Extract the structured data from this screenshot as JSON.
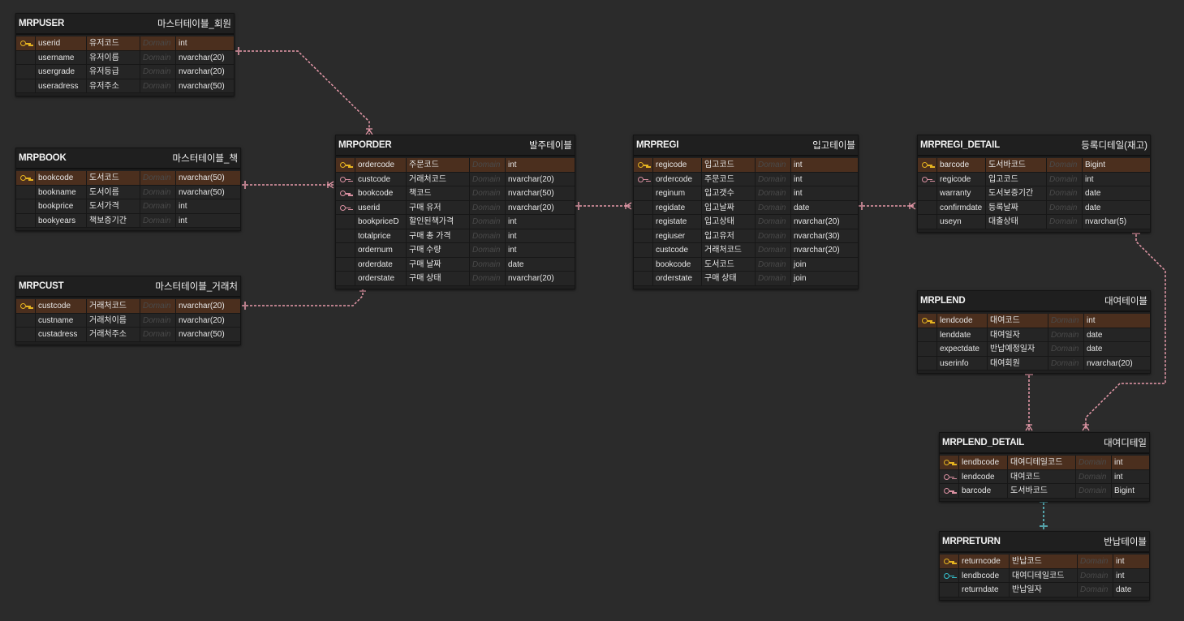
{
  "entities": [
    {
      "id": "mrpuser",
      "name": "MRPUSER",
      "label": "마스터테이블_회원",
      "columns": [
        {
          "key": "pk",
          "physical": "userid",
          "logical": "유저코드",
          "domain": "Domain",
          "type": "int"
        },
        {
          "key": "",
          "physical": "username",
          "logical": "유저이름",
          "domain": "Domain",
          "type": "nvarchar(20)"
        },
        {
          "key": "",
          "physical": "usergrade",
          "logical": "유저등급",
          "domain": "Domain",
          "type": "nvarchar(20)"
        },
        {
          "key": "",
          "physical": "useradress",
          "logical": "유저주소",
          "domain": "Domain",
          "type": "nvarchar(50)"
        }
      ]
    },
    {
      "id": "mrpbook",
      "name": "MRPBOOK",
      "label": "마스터테이블_책",
      "columns": [
        {
          "key": "pk",
          "physical": "bookcode",
          "logical": "도서코드",
          "domain": "Domain",
          "type": "nvarchar(50)"
        },
        {
          "key": "",
          "physical": "bookname",
          "logical": "도서이름",
          "domain": "Domain",
          "type": "nvarchar(50)"
        },
        {
          "key": "",
          "physical": "bookprice",
          "logical": "도서가격",
          "domain": "Domain",
          "type": "int"
        },
        {
          "key": "",
          "physical": "bookyears",
          "logical": "책보증기간",
          "domain": "Domain",
          "type": "int"
        }
      ]
    },
    {
      "id": "mrpcust",
      "name": "MRPCUST",
      "label": "마스터테이블_거래처",
      "columns": [
        {
          "key": "pk",
          "physical": "custcode",
          "logical": "거래처코드",
          "domain": "Domain",
          "type": "nvarchar(20)"
        },
        {
          "key": "",
          "physical": "custname",
          "logical": "거래처이름",
          "domain": "Domain",
          "type": "nvarchar(20)"
        },
        {
          "key": "",
          "physical": "custadress",
          "logical": "거래처주소",
          "domain": "Domain",
          "type": "nvarchar(50)"
        }
      ]
    },
    {
      "id": "mrporder",
      "name": "MRPORDER",
      "label": "발주테이블",
      "columns": [
        {
          "key": "pk",
          "physical": "ordercode",
          "logical": "주문코드",
          "domain": "Domain",
          "type": "int"
        },
        {
          "key": "fk",
          "physical": "custcode",
          "logical": "거래처코드",
          "domain": "Domain",
          "type": "nvarchar(20)"
        },
        {
          "key": "fk",
          "physical": "bookcode",
          "logical": "책코드",
          "domain": "Domain",
          "type": "nvarchar(50)"
        },
        {
          "key": "fk",
          "physical": "userid",
          "logical": "구매 유저",
          "domain": "Domain",
          "type": "nvarchar(20)"
        },
        {
          "key": "",
          "physical": "bookpriceD",
          "logical": "할인된책가격",
          "domain": "Domain",
          "type": "int"
        },
        {
          "key": "",
          "physical": "totalprice",
          "logical": "구매 총 가격",
          "domain": "Domain",
          "type": "int"
        },
        {
          "key": "",
          "physical": "ordernum",
          "logical": "구매 수량",
          "domain": "Domain",
          "type": "int"
        },
        {
          "key": "",
          "physical": "orderdate",
          "logical": "구매 날짜",
          "domain": "Domain",
          "type": "date"
        },
        {
          "key": "",
          "physical": "orderstate",
          "logical": "구매 상태",
          "domain": "Domain",
          "type": "nvarchar(20)"
        }
      ]
    },
    {
      "id": "mrpregi",
      "name": "MRPREGI",
      "label": "입고테이블",
      "columns": [
        {
          "key": "pk",
          "physical": "regicode",
          "logical": "입고코드",
          "domain": "Domain",
          "type": "int"
        },
        {
          "key": "fk",
          "physical": "ordercode",
          "logical": "주문코드",
          "domain": "Domain",
          "type": "int"
        },
        {
          "key": "",
          "physical": "reginum",
          "logical": "입고갯수",
          "domain": "Domain",
          "type": "int"
        },
        {
          "key": "",
          "physical": "regidate",
          "logical": "입고날짜",
          "domain": "Domain",
          "type": "date"
        },
        {
          "key": "",
          "physical": "registate",
          "logical": "입고상태",
          "domain": "Domain",
          "type": "nvarchar(20)"
        },
        {
          "key": "",
          "physical": "regiuser",
          "logical": "입고유저",
          "domain": "Domain",
          "type": "nvarchar(30)"
        },
        {
          "key": "",
          "physical": "custcode",
          "logical": "거래처코드",
          "domain": "Domain",
          "type": "nvarchar(20)"
        },
        {
          "key": "",
          "physical": "bookcode",
          "logical": "도서코드",
          "domain": "Domain",
          "type": "join"
        },
        {
          "key": "",
          "physical": "orderstate",
          "logical": "구매 상태",
          "domain": "Domain",
          "type": "join"
        }
      ]
    },
    {
      "id": "mrpregi_detail",
      "name": "MRPREGI_DETAIL",
      "label": "등록디테일(재고)",
      "columns": [
        {
          "key": "pk",
          "physical": "barcode",
          "logical": "도서바코드",
          "domain": "Domain",
          "type": "Bigint"
        },
        {
          "key": "fk",
          "physical": "regicode",
          "logical": "입고코드",
          "domain": "Domain",
          "type": "int"
        },
        {
          "key": "",
          "physical": "warranty",
          "logical": "도서보증기간",
          "domain": "Domain",
          "type": "date"
        },
        {
          "key": "",
          "physical": "confirmdate",
          "logical": "등록날짜",
          "domain": "Domain",
          "type": "date"
        },
        {
          "key": "",
          "physical": "useyn",
          "logical": "대출상태",
          "domain": "Domain",
          "type": "nvarchar(5)"
        }
      ]
    },
    {
      "id": "mrplend",
      "name": "MRPLEND",
      "label": "대여테이블",
      "columns": [
        {
          "key": "pk",
          "physical": "lendcode",
          "logical": "대여코드",
          "domain": "Domain",
          "type": "int"
        },
        {
          "key": "",
          "physical": "lenddate",
          "logical": "대여일자",
          "domain": "Domain",
          "type": "date"
        },
        {
          "key": "",
          "physical": "expectdate",
          "logical": "반납예정일자",
          "domain": "Domain",
          "type": "date"
        },
        {
          "key": "",
          "physical": "userinfo",
          "logical": "대여회원",
          "domain": "Domain",
          "type": "nvarchar(20)"
        }
      ]
    },
    {
      "id": "mrplend_detail",
      "name": "MRPLEND_DETAIL",
      "label": "대여디테일",
      "columns": [
        {
          "key": "pk",
          "physical": "lendbcode",
          "logical": "대여디테일코드",
          "domain": "Domain",
          "type": "int"
        },
        {
          "key": "fk",
          "physical": "lendcode",
          "logical": "대여코드",
          "domain": "Domain",
          "type": "int"
        },
        {
          "key": "fk",
          "physical": "barcode",
          "logical": "도서바코드",
          "domain": "Domain",
          "type": "Bigint"
        }
      ]
    },
    {
      "id": "mrpreturn",
      "name": "MRPRETURN",
      "label": "반납테이블",
      "columns": [
        {
          "key": "pk",
          "physical": "returncode",
          "logical": "반납코드",
          "domain": "Domain",
          "type": "int"
        },
        {
          "key": "pfk",
          "physical": "lendbcode",
          "logical": "대여디테일코드",
          "domain": "Domain",
          "type": "int"
        },
        {
          "key": "",
          "physical": "returndate",
          "logical": "반납일자",
          "domain": "Domain",
          "type": "date"
        }
      ]
    }
  ],
  "relationships": [
    {
      "from": "mrpuser",
      "to": "mrporder",
      "color": "#e79aaa"
    },
    {
      "from": "mrpbook",
      "to": "mrporder",
      "color": "#e79aaa"
    },
    {
      "from": "mrpcust",
      "to": "mrporder",
      "color": "#e79aaa"
    },
    {
      "from": "mrporder",
      "to": "mrpregi",
      "color": "#e79aaa"
    },
    {
      "from": "mrpregi",
      "to": "mrpregi_detail",
      "color": "#e79aaa"
    },
    {
      "from": "mrplend",
      "to": "mrplend_detail",
      "color": "#e79aaa"
    },
    {
      "from": "mrpregi_detail",
      "to": "mrplend_detail",
      "color": "#e79aaa"
    },
    {
      "from": "mrplend_detail",
      "to": "mrpreturn",
      "color": "#62c9d3"
    }
  ]
}
